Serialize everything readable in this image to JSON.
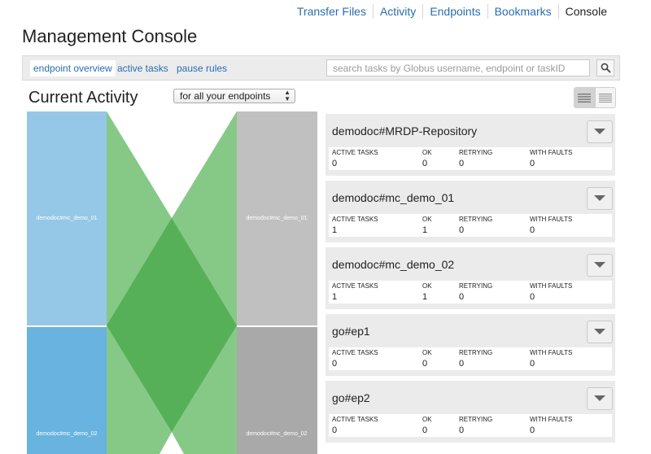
{
  "nav": {
    "links": [
      "Transfer Files",
      "Activity",
      "Endpoints",
      "Bookmarks",
      "Console"
    ]
  },
  "page_title": "Management Console",
  "tabs": [
    "endpoint overview",
    "active tasks",
    "pause rules"
  ],
  "search": {
    "placeholder": "search tasks by Globus username, endpoint or taskID",
    "icon": "magnifier-icon"
  },
  "activity": {
    "title": "Current Activity",
    "filter_selected": "for all your endpoints"
  },
  "flow": {
    "left_nodes": [
      "demodoc#mc_demo_01",
      "demodoc#mc_demo_02"
    ],
    "right_nodes": [
      "demodoc#mc_demo_01",
      "demodoc#mc_demo_02"
    ],
    "colors": {
      "left_top": "#95c8e6",
      "left_bottom": "#68b3df",
      "right_top": "#c0c0c0",
      "right_bottom": "#a9a9a9",
      "link": "#86c987",
      "overlap": "#56b058"
    }
  },
  "stat_labels": [
    "ACTIVE TASKS",
    "OK",
    "RETRYING",
    "WITH FAULTS"
  ],
  "endpoints": [
    {
      "name": "demodoc#MRDP-Repository",
      "active": "0",
      "ok": "0",
      "retrying": "0",
      "faults": "0"
    },
    {
      "name": "demodoc#mc_demo_01",
      "active": "1",
      "ok": "1",
      "retrying": "0",
      "faults": "0"
    },
    {
      "name": "demodoc#mc_demo_02",
      "active": "1",
      "ok": "1",
      "retrying": "0",
      "faults": "0"
    },
    {
      "name": "go#ep1",
      "active": "0",
      "ok": "0",
      "retrying": "0",
      "faults": "0"
    },
    {
      "name": "go#ep2",
      "active": "0",
      "ok": "0",
      "retrying": "0",
      "faults": "0"
    }
  ]
}
